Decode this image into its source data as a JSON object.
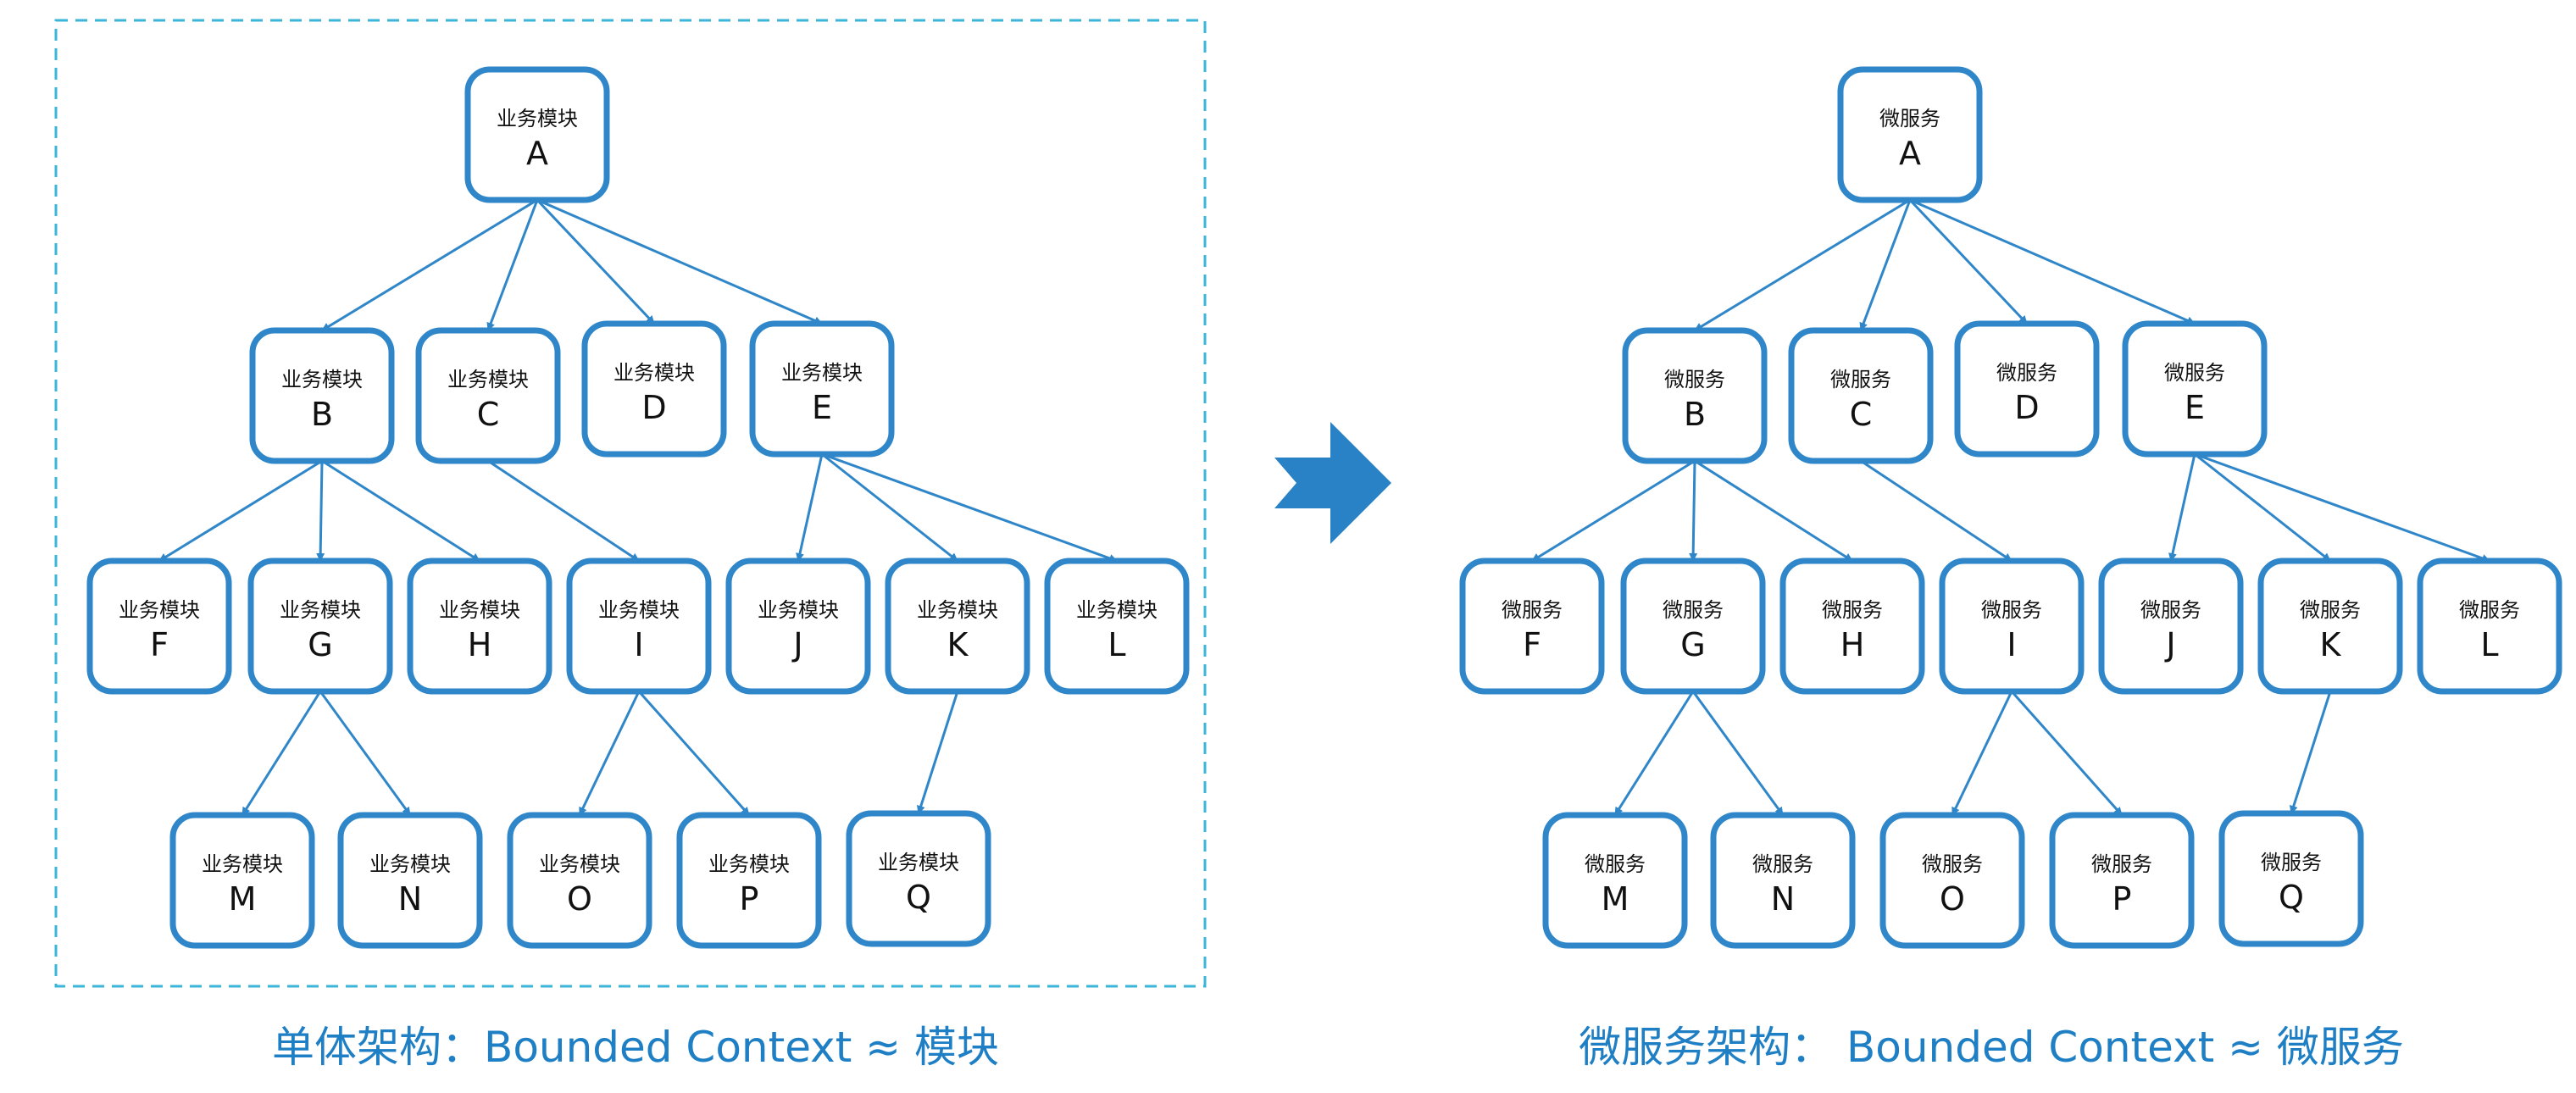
{
  "monolith": {
    "node_label": "业务模块",
    "caption": "单体架构：Bounded Context ≈ 模块"
  },
  "microservices": {
    "node_label": "微服务",
    "caption": "微服务架构： Bounded Context  ≈ 微服务"
  },
  "nodes": [
    "A",
    "B",
    "C",
    "D",
    "E",
    "F",
    "G",
    "H",
    "I",
    "J",
    "K",
    "L",
    "M",
    "N",
    "O",
    "P",
    "Q"
  ],
  "edges": [
    [
      "A",
      "B"
    ],
    [
      "A",
      "C"
    ],
    [
      "A",
      "D"
    ],
    [
      "A",
      "E"
    ],
    [
      "B",
      "F"
    ],
    [
      "B",
      "G"
    ],
    [
      "B",
      "H"
    ],
    [
      "C",
      "I"
    ],
    [
      "E",
      "J"
    ],
    [
      "E",
      "K"
    ],
    [
      "E",
      "L"
    ],
    [
      "G",
      "M"
    ],
    [
      "G",
      "N"
    ],
    [
      "I",
      "O"
    ],
    [
      "I",
      "P"
    ],
    [
      "K",
      "Q"
    ]
  ],
  "colors": {
    "accent": "#2f86c8",
    "border_dashed": "#3bb6d8",
    "arrow": "#2a82c6"
  },
  "icons": {
    "transition": "right-arrow-icon"
  }
}
